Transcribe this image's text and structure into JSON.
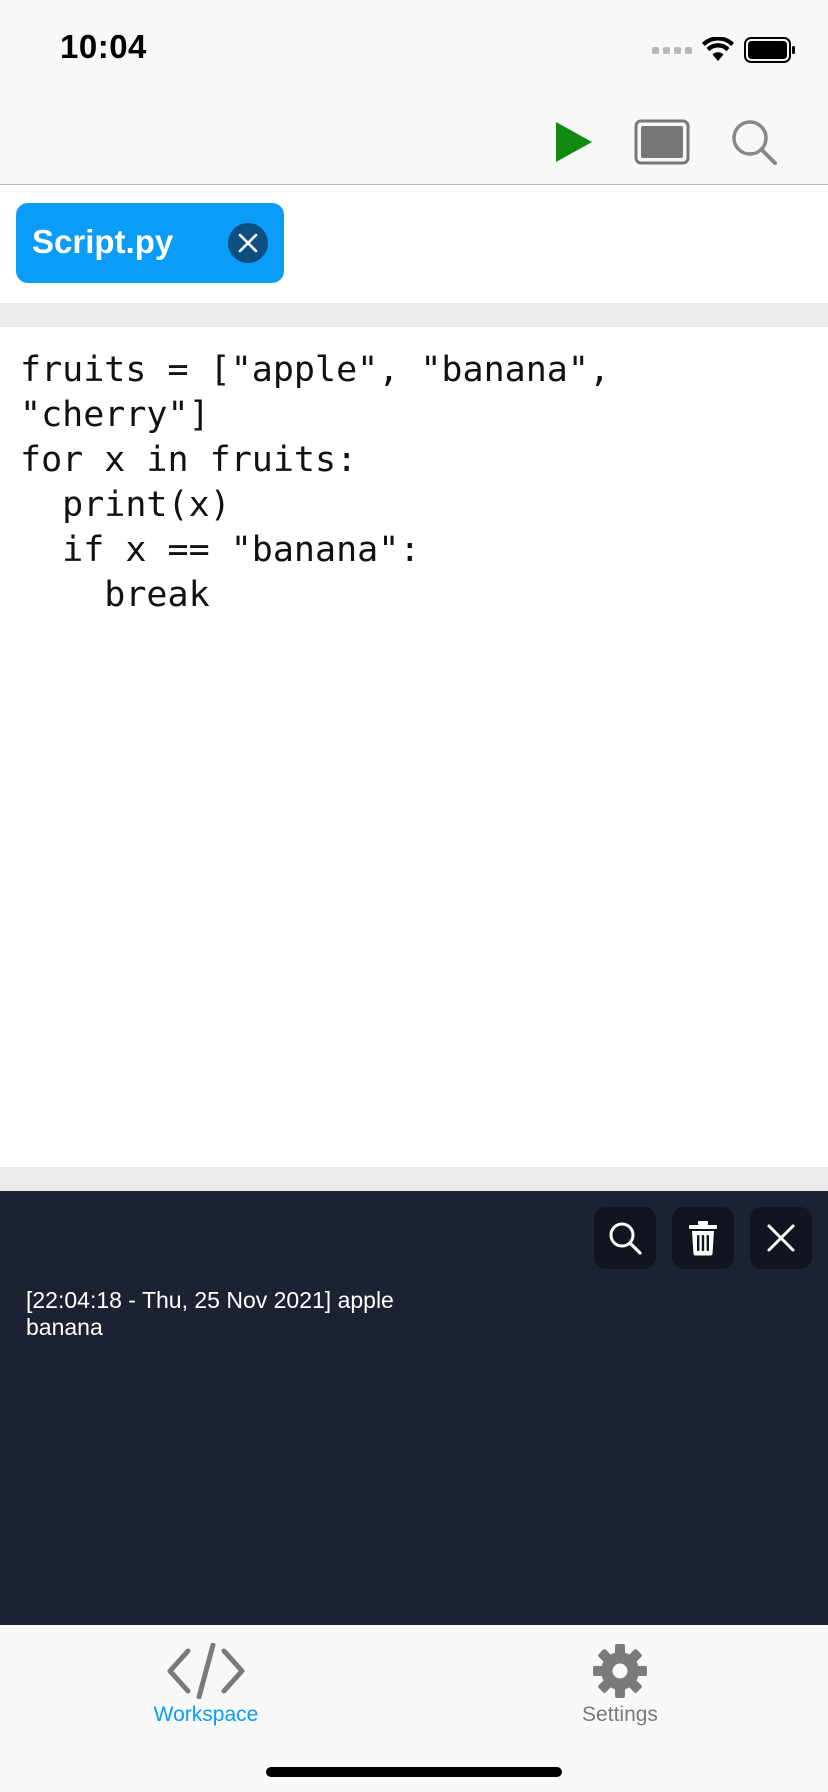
{
  "status_bar": {
    "time": "10:04"
  },
  "toolbar": {
    "run_icon": "play-icon",
    "console_icon": "console-window-icon",
    "search_icon": "search-icon"
  },
  "open_tabs": [
    {
      "label": "Script.py",
      "active": true
    }
  ],
  "editor": {
    "lines": [
      "fruits = [\"apple\", \"banana\",",
      "\"cherry\"]",
      "for x in fruits:",
      "  print(x)",
      "  if x == \"banana\":",
      "    break"
    ]
  },
  "console": {
    "output_lines": [
      "[22:04:18 - Thu, 25 Nov 2021] apple",
      "banana"
    ]
  },
  "tab_bar": {
    "items": [
      {
        "label": "Workspace",
        "icon": "code-icon",
        "active": true
      },
      {
        "label": "Settings",
        "icon": "gear-icon",
        "active": false
      }
    ]
  },
  "colors": {
    "accent": "#0a9cf9",
    "run_green": "#128a12",
    "console_bg": "#1d2232",
    "inactive_tab": "#7a7a7a"
  }
}
